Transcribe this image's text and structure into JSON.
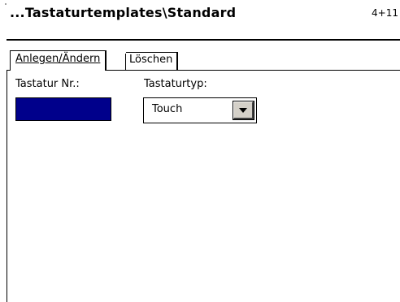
{
  "header": {
    "title": "...Tastaturtemplates\\Standard",
    "page_indicator": "4+11"
  },
  "tabs": [
    {
      "label": "Anlegen/Ändern",
      "active": true
    },
    {
      "label": "Löschen",
      "active": false
    }
  ],
  "form": {
    "keyboard_number_label": "Tastatur Nr.:",
    "keyboard_number_value": "",
    "keyboard_number_fill_color": "#00008b",
    "keyboard_type_label": "Tastaturtyp:",
    "keyboard_type_value": "Touch"
  },
  "icons": {
    "dropdown": "chevron-down-icon"
  }
}
